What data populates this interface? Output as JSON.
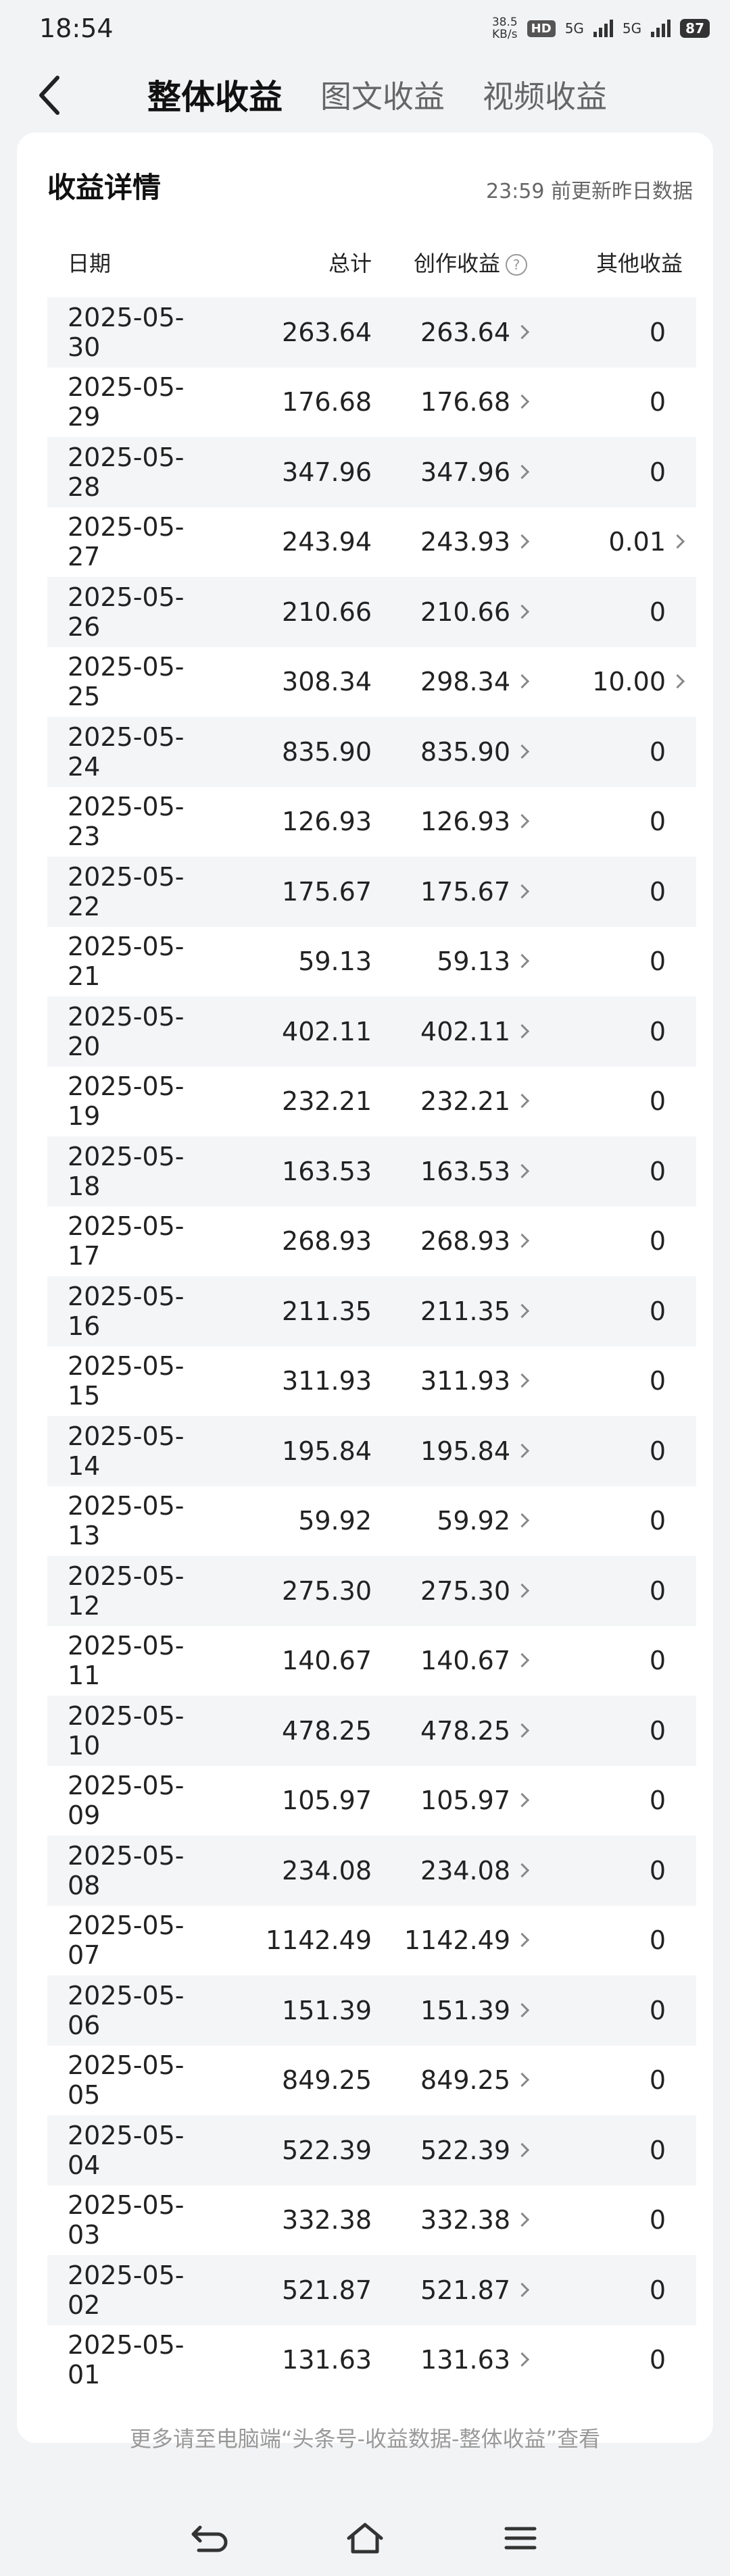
{
  "status": {
    "time": "18:54",
    "netspeed_value": "38.5",
    "netspeed_unit": "KB/s",
    "hd_label": "HD",
    "network_a": "5G",
    "network_b": "5G",
    "battery": "87"
  },
  "tabs": [
    "整体收益",
    "图文收益",
    "视频收益"
  ],
  "card": {
    "title": "收益详情",
    "update_note": "23:59 前更新昨日数据"
  },
  "table": {
    "headers": {
      "date": "日期",
      "total": "总计",
      "creation": "创作收益",
      "other": "其他收益"
    },
    "rows": [
      {
        "date": "2025-05-30",
        "total": "263.64",
        "creation": "263.64",
        "other": "0"
      },
      {
        "date": "2025-05-29",
        "total": "176.68",
        "creation": "176.68",
        "other": "0"
      },
      {
        "date": "2025-05-28",
        "total": "347.96",
        "creation": "347.96",
        "other": "0"
      },
      {
        "date": "2025-05-27",
        "total": "243.94",
        "creation": "243.93",
        "other": "0.01"
      },
      {
        "date": "2025-05-26",
        "total": "210.66",
        "creation": "210.66",
        "other": "0"
      },
      {
        "date": "2025-05-25",
        "total": "308.34",
        "creation": "298.34",
        "other": "10.00"
      },
      {
        "date": "2025-05-24",
        "total": "835.90",
        "creation": "835.90",
        "other": "0"
      },
      {
        "date": "2025-05-23",
        "total": "126.93",
        "creation": "126.93",
        "other": "0"
      },
      {
        "date": "2025-05-22",
        "total": "175.67",
        "creation": "175.67",
        "other": "0"
      },
      {
        "date": "2025-05-21",
        "total": "59.13",
        "creation": "59.13",
        "other": "0"
      },
      {
        "date": "2025-05-20",
        "total": "402.11",
        "creation": "402.11",
        "other": "0"
      },
      {
        "date": "2025-05-19",
        "total": "232.21",
        "creation": "232.21",
        "other": "0"
      },
      {
        "date": "2025-05-18",
        "total": "163.53",
        "creation": "163.53",
        "other": "0"
      },
      {
        "date": "2025-05-17",
        "total": "268.93",
        "creation": "268.93",
        "other": "0"
      },
      {
        "date": "2025-05-16",
        "total": "211.35",
        "creation": "211.35",
        "other": "0"
      },
      {
        "date": "2025-05-15",
        "total": "311.93",
        "creation": "311.93",
        "other": "0"
      },
      {
        "date": "2025-05-14",
        "total": "195.84",
        "creation": "195.84",
        "other": "0"
      },
      {
        "date": "2025-05-13",
        "total": "59.92",
        "creation": "59.92",
        "other": "0"
      },
      {
        "date": "2025-05-12",
        "total": "275.30",
        "creation": "275.30",
        "other": "0"
      },
      {
        "date": "2025-05-11",
        "total": "140.67",
        "creation": "140.67",
        "other": "0"
      },
      {
        "date": "2025-05-10",
        "total": "478.25",
        "creation": "478.25",
        "other": "0"
      },
      {
        "date": "2025-05-09",
        "total": "105.97",
        "creation": "105.97",
        "other": "0"
      },
      {
        "date": "2025-05-08",
        "total": "234.08",
        "creation": "234.08",
        "other": "0"
      },
      {
        "date": "2025-05-07",
        "total": "1142.49",
        "creation": "1142.49",
        "other": "0"
      },
      {
        "date": "2025-05-06",
        "total": "151.39",
        "creation": "151.39",
        "other": "0"
      },
      {
        "date": "2025-05-05",
        "total": "849.25",
        "creation": "849.25",
        "other": "0"
      },
      {
        "date": "2025-05-04",
        "total": "522.39",
        "creation": "522.39",
        "other": "0"
      },
      {
        "date": "2025-05-03",
        "total": "332.38",
        "creation": "332.38",
        "other": "0"
      },
      {
        "date": "2025-05-02",
        "total": "521.87",
        "creation": "521.87",
        "other": "0"
      },
      {
        "date": "2025-05-01",
        "total": "131.63",
        "creation": "131.63",
        "other": "0"
      }
    ]
  },
  "footnote": "更多请至电脑端“头条号-收益数据-整体收益”查看",
  "icons": {
    "back": "back-arrow-icon",
    "help": "question-circle-icon",
    "chevron": "chevron-right-icon",
    "nav_back": "return-icon",
    "nav_home": "home-icon",
    "nav_menu": "menu-icon"
  }
}
